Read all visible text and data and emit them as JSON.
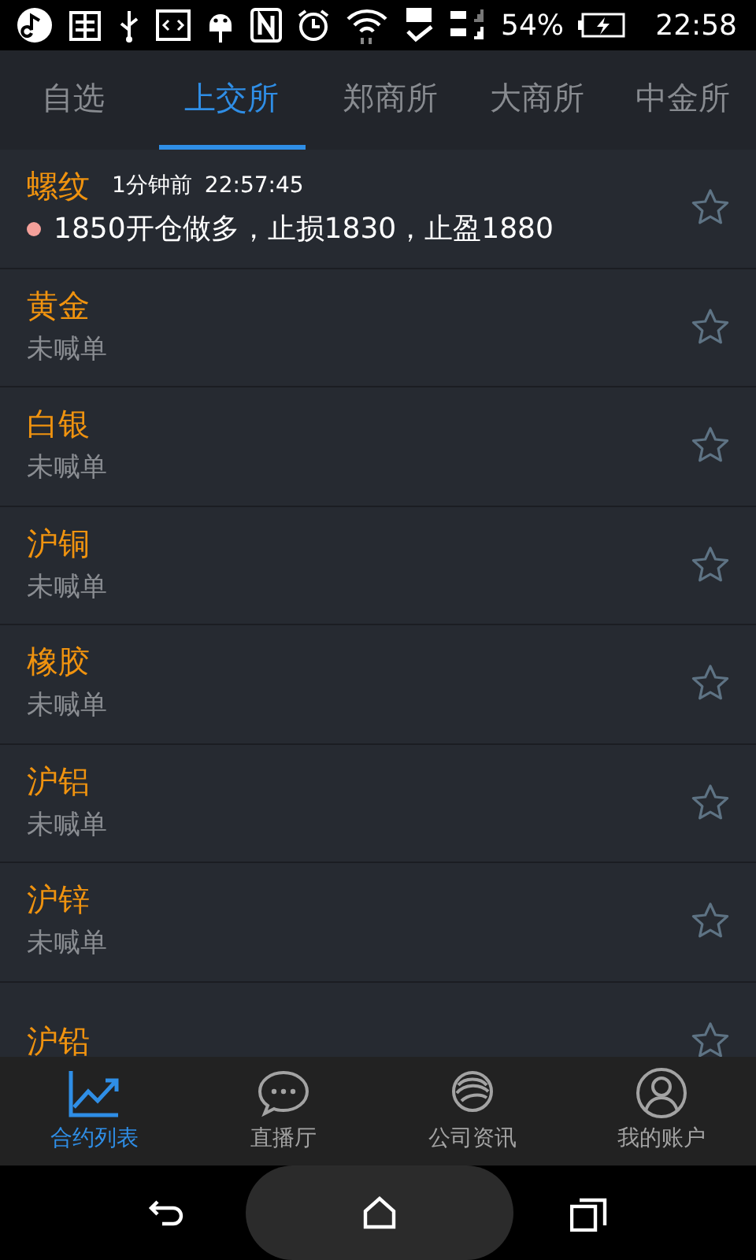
{
  "status_bar": {
    "battery": "54%",
    "time": "22:58"
  },
  "tabs": [
    {
      "label": "自选",
      "selected": false
    },
    {
      "label": "上交所",
      "selected": true
    },
    {
      "label": "郑商所",
      "selected": false
    },
    {
      "label": "大商所",
      "selected": false
    },
    {
      "label": "中金所",
      "selected": false
    }
  ],
  "contracts": [
    {
      "kind": "signal",
      "name": "螺纹",
      "time_ago": "1分钟前",
      "time": "22:57:45",
      "message": "1850开仓做多，止损1830，止盈1880",
      "starred": false
    },
    {
      "kind": "plain",
      "name": "黄金",
      "subtitle": "未喊单",
      "starred": false
    },
    {
      "kind": "plain",
      "name": "白银",
      "subtitle": "未喊单",
      "starred": false
    },
    {
      "kind": "plain",
      "name": "沪铜",
      "subtitle": "未喊单",
      "starred": false
    },
    {
      "kind": "plain",
      "name": "橡胶",
      "subtitle": "未喊单",
      "starred": false
    },
    {
      "kind": "plain",
      "name": "沪铝",
      "subtitle": "未喊单",
      "starred": false
    },
    {
      "kind": "plain",
      "name": "沪锌",
      "subtitle": "未喊单",
      "starred": false
    },
    {
      "kind": "plain",
      "name": "沪铅",
      "starred": false
    }
  ],
  "bottom_nav": [
    {
      "label": "合约列表",
      "selected": true
    },
    {
      "label": "直播厅",
      "selected": false
    },
    {
      "label": "公司资讯",
      "selected": false
    },
    {
      "label": "我的账户",
      "selected": false
    }
  ]
}
